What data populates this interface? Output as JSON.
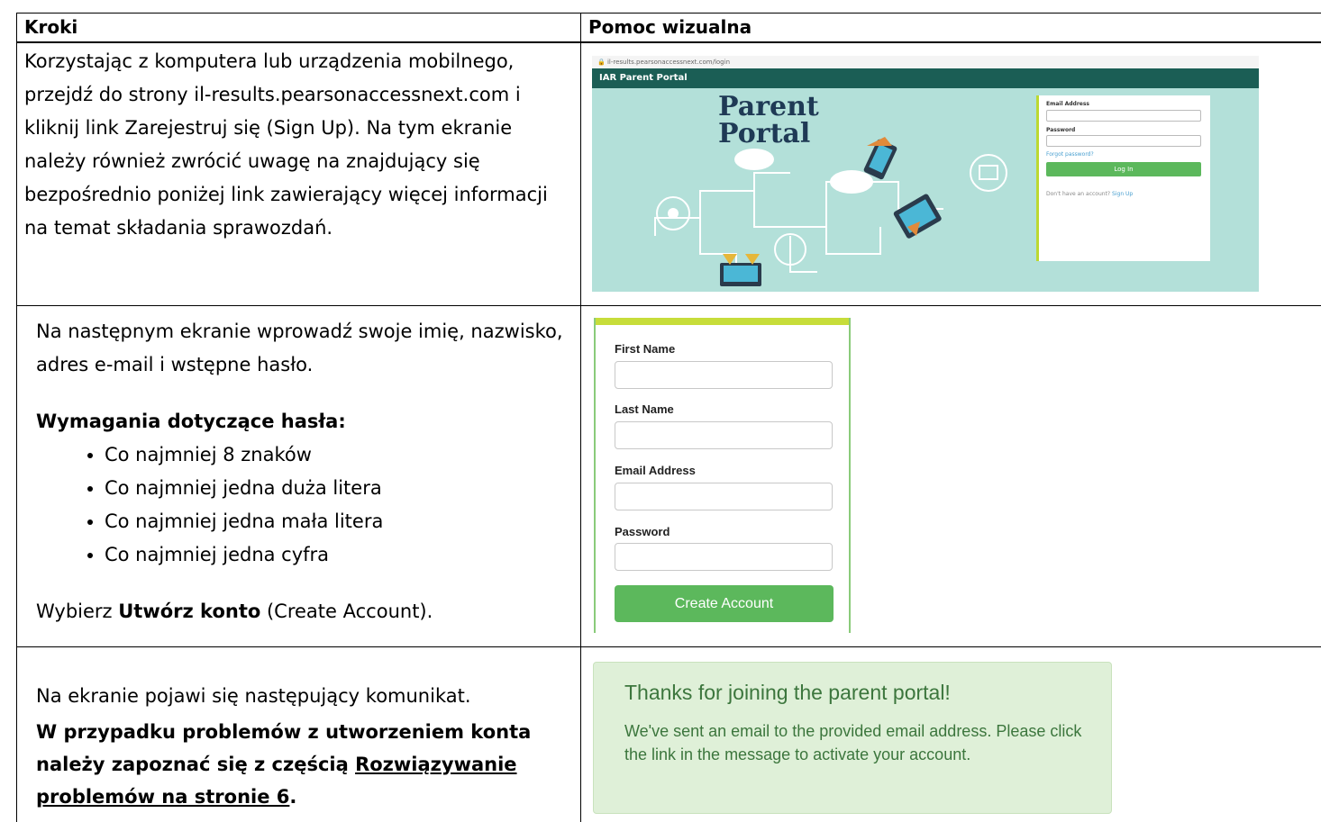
{
  "table": {
    "col_steps": "Kroki",
    "col_visual": "Pomoc wizualna"
  },
  "row1": {
    "step_text": "Korzystając z komputera lub urządzenia mobilnego, przejdź do strony il-results.pearsonaccessnext.com i kliknij link Zarejestruj się (Sign Up). Na tym ekranie należy również zwrócić uwagę na znajdujący się bezpośrednio poniżej link zawierający więcej informacji na temat składania sprawozdań.",
    "screenshot": {
      "url": "il-results.pearsonaccessnext.com/login",
      "nav_title": "IAR Parent Portal",
      "title_line1": "Parent",
      "title_line2": "Portal",
      "email_label": "Email Address",
      "password_label": "Password",
      "forgot_link": "Forgot password?",
      "login_button": "Log In",
      "no_account_text": "Don't have an account?",
      "sign_up_link": "Sign Up"
    }
  },
  "row2": {
    "intro": "Na następnym ekranie wprowadź swoje imię, nazwisko, adres e-mail i wstępne hasło.",
    "req_heading": "Wymagania dotyczące hasła:",
    "requirements": [
      "Co najmniej 8 znaków",
      "Co najmniej jedna duża litera",
      "Co najmniej jedna mała litera",
      "Co najmniej jedna cyfra"
    ],
    "choose_prefix": "Wybierz ",
    "choose_bold": "Utwórz konto",
    "choose_suffix": " (Create Account).",
    "form": {
      "first_name": "First Name",
      "last_name": "Last Name",
      "email": "Email Address",
      "password": "Password",
      "create_button": "Create Account"
    }
  },
  "row3": {
    "line1": "Na ekranie pojawi się następujący komunikat.",
    "bold_prefix": "W przypadku problemów z utworzeniem konta należy zapoznać się z częścią ",
    "link_text": "Rozwiązywanie problemów na stronie 6",
    "bold_suffix": ".",
    "message": {
      "heading": "Thanks for joining the parent portal!",
      "body": "We've sent an email to the provided email address. Please click the link in the message to activate your account."
    }
  },
  "colors": {
    "portal_bg": "#b3e0d9",
    "portal_nav": "#1b5e55",
    "button_green": "#5cb85c",
    "success_bg": "#dff0d8",
    "success_text": "#3c763d"
  }
}
